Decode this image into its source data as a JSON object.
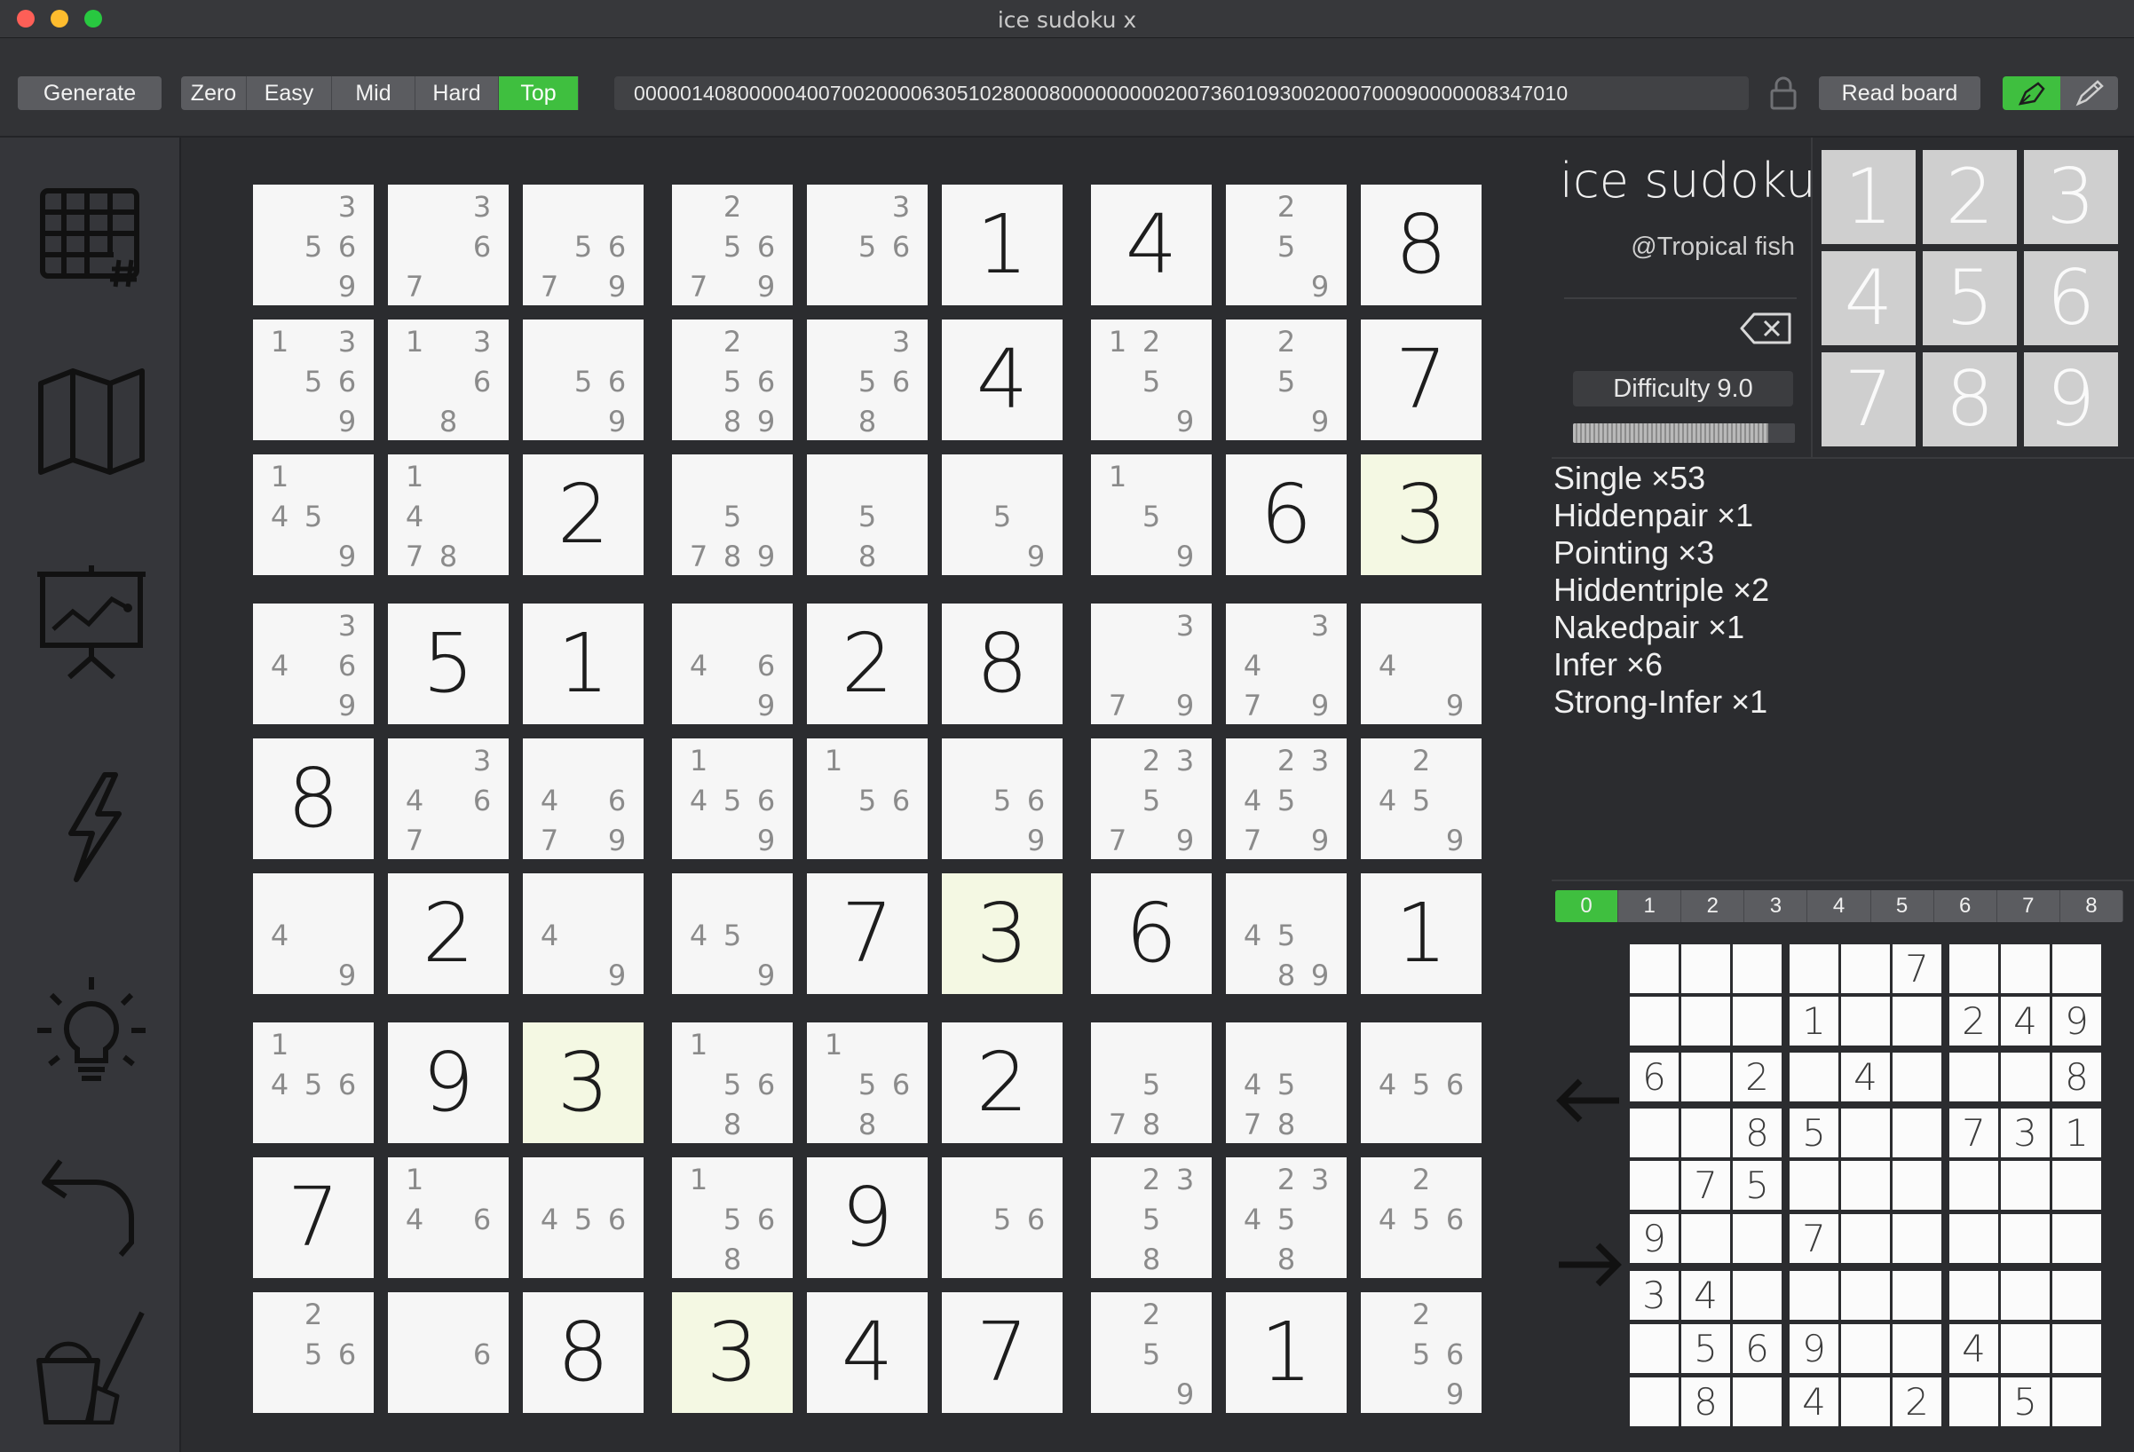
{
  "window": {
    "title": "ice sudoku x"
  },
  "toolbar": {
    "generate": "Generate",
    "difficulties": [
      "Zero",
      "Easy",
      "Mid",
      "Hard",
      "Top"
    ],
    "active_difficulty": "Top",
    "puzzle_string": "000001408000004007002000063051028000800000000020073601093002000700090000008347010",
    "read_board": "Read board",
    "accent_color": "#3fbf3f"
  },
  "sidebar": {
    "icons": [
      "grid-hash-icon",
      "map-icon",
      "presentation-chart-icon",
      "lightning-icon",
      "lightbulb-icon",
      "undo-icon",
      "clean-bucket-icon"
    ]
  },
  "board": {
    "cells": [
      {
        "c": [
          3,
          5,
          6,
          9
        ]
      },
      {
        "c": [
          3,
          6,
          7
        ]
      },
      {
        "c": [
          5,
          6,
          7,
          9
        ]
      },
      {
        "c": [
          2,
          5,
          6,
          7,
          9
        ]
      },
      {
        "c": [
          3,
          5,
          6
        ]
      },
      {
        "v": 1
      },
      {
        "v": 4
      },
      {
        "c": [
          2,
          5,
          9
        ]
      },
      {
        "v": 8
      },
      {
        "c": [
          1,
          3,
          5,
          6,
          9
        ]
      },
      {
        "c": [
          1,
          3,
          6,
          8
        ]
      },
      {
        "c": [
          5,
          6,
          9
        ]
      },
      {
        "c": [
          2,
          5,
          6,
          8,
          9
        ]
      },
      {
        "c": [
          3,
          5,
          6,
          8
        ]
      },
      {
        "v": 4
      },
      {
        "c": [
          1,
          2,
          5,
          9
        ]
      },
      {
        "c": [
          2,
          5,
          9
        ]
      },
      {
        "v": 7
      },
      {
        "c": [
          1,
          4,
          5,
          9
        ]
      },
      {
        "c": [
          1,
          4,
          7,
          8
        ]
      },
      {
        "v": 2
      },
      {
        "c": [
          5,
          7,
          8,
          9
        ]
      },
      {
        "c": [
          5,
          8
        ]
      },
      {
        "c": [
          5,
          9
        ]
      },
      {
        "c": [
          1,
          5,
          9
        ]
      },
      {
        "v": 6
      },
      {
        "v": 3,
        "h": true
      },
      {
        "c": [
          3,
          4,
          6,
          9
        ]
      },
      {
        "v": 5
      },
      {
        "v": 1
      },
      {
        "c": [
          4,
          6,
          9
        ]
      },
      {
        "v": 2
      },
      {
        "v": 8
      },
      {
        "c": [
          3,
          7,
          9
        ]
      },
      {
        "c": [
          3,
          4,
          7,
          9
        ]
      },
      {
        "c": [
          4,
          9
        ]
      },
      {
        "v": 8
      },
      {
        "c": [
          3,
          4,
          6,
          7
        ]
      },
      {
        "c": [
          4,
          6,
          7,
          9
        ]
      },
      {
        "c": [
          1,
          4,
          5,
          6,
          9
        ]
      },
      {
        "c": [
          1,
          5,
          6
        ]
      },
      {
        "c": [
          5,
          6,
          9
        ]
      },
      {
        "c": [
          2,
          3,
          5,
          7,
          9
        ]
      },
      {
        "c": [
          2,
          3,
          4,
          5,
          7,
          9
        ]
      },
      {
        "c": [
          2,
          4,
          5,
          9
        ]
      },
      {
        "c": [
          4,
          9
        ]
      },
      {
        "v": 2
      },
      {
        "c": [
          4,
          9
        ]
      },
      {
        "c": [
          4,
          5,
          9
        ]
      },
      {
        "v": 7
      },
      {
        "v": 3,
        "h": true
      },
      {
        "v": 6
      },
      {
        "c": [
          4,
          5,
          8,
          9
        ]
      },
      {
        "v": 1
      },
      {
        "c": [
          1,
          4,
          5,
          6
        ]
      },
      {
        "v": 9
      },
      {
        "v": 3,
        "h": true
      },
      {
        "c": [
          1,
          5,
          6,
          8
        ]
      },
      {
        "c": [
          1,
          5,
          6,
          8
        ]
      },
      {
        "v": 2
      },
      {
        "c": [
          5,
          7,
          8
        ]
      },
      {
        "c": [
          4,
          5,
          7,
          8
        ]
      },
      {
        "c": [
          4,
          5,
          6
        ]
      },
      {
        "v": 7
      },
      {
        "c": [
          1,
          4,
          6
        ]
      },
      {
        "c": [
          4,
          5,
          6
        ]
      },
      {
        "c": [
          1,
          5,
          6,
          8
        ]
      },
      {
        "v": 9
      },
      {
        "c": [
          5,
          6
        ]
      },
      {
        "c": [
          2,
          3,
          5,
          8
        ]
      },
      {
        "c": [
          2,
          3,
          4,
          5,
          8
        ]
      },
      {
        "c": [
          2,
          4,
          5,
          6
        ]
      },
      {
        "c": [
          2,
          5,
          6
        ]
      },
      {
        "c": [
          6
        ]
      },
      {
        "v": 8
      },
      {
        "v": 3,
        "h": true
      },
      {
        "v": 4
      },
      {
        "v": 7
      },
      {
        "c": [
          2,
          5,
          9
        ]
      },
      {
        "v": 1
      },
      {
        "c": [
          2,
          5,
          6,
          9
        ]
      }
    ]
  },
  "info": {
    "brand": "ice sudoku",
    "author": "@Tropical fish",
    "difficulty_label": "Difficulty 9.0",
    "difficulty_progress": 0.88
  },
  "numpad": [
    "1",
    "2",
    "3",
    "4",
    "5",
    "6",
    "7",
    "8",
    "9"
  ],
  "techniques": [
    "Single ×53",
    "Hiddenpair ×1",
    "Pointing ×3",
    "Hiddentriple ×2",
    "Nakedpair ×1",
    "Infer ×6",
    "Strong-Infer ×1"
  ],
  "step_tabs": [
    "0",
    "1",
    "2",
    "3",
    "4",
    "5",
    "6",
    "7",
    "8"
  ],
  "active_step": "0",
  "mini_grid": [
    [
      "",
      "",
      "",
      "",
      "",
      "7",
      "",
      "",
      ""
    ],
    [
      "",
      "",
      "",
      "1",
      "",
      "",
      "2",
      "4",
      "9"
    ],
    [
      "6",
      "",
      "2",
      "",
      "4",
      "",
      "",
      "",
      "8"
    ],
    [
      "",
      "",
      "8",
      "5",
      "",
      "",
      "7",
      "3",
      "1"
    ],
    [
      "",
      "7",
      "5",
      "",
      "",
      "",
      "",
      "",
      ""
    ],
    [
      "9",
      "",
      "",
      "7",
      "",
      "",
      "",
      "",
      ""
    ],
    [
      "3",
      "4",
      "",
      "",
      "",
      "",
      "",
      "",
      ""
    ],
    [
      "",
      "5",
      "6",
      "9",
      "",
      "",
      "4",
      "",
      ""
    ],
    [
      "",
      "8",
      "",
      "4",
      "",
      "2",
      "",
      "5",
      ""
    ]
  ]
}
